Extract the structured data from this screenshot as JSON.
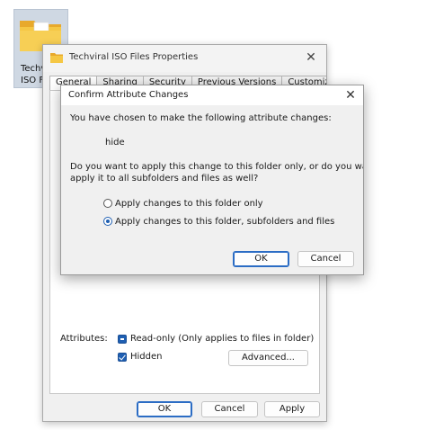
{
  "desktop": {
    "folder_label_line1": "Techvi",
    "folder_label_line2": "ISO F"
  },
  "properties_window": {
    "title": "Techviral ISO Files Properties",
    "tabs": [
      {
        "label": "General",
        "active": true
      },
      {
        "label": "Sharing",
        "active": false
      },
      {
        "label": "Security",
        "active": false
      },
      {
        "label": "Previous Versions",
        "active": false
      },
      {
        "label": "Customize",
        "active": false
      }
    ],
    "attributes_label": "Attributes:",
    "readonly_label": "Read-only (Only applies to files in folder)",
    "hidden_label": "Hidden",
    "advanced_button": "Advanced...",
    "ok_button": "OK",
    "cancel_button": "Cancel",
    "apply_button": "Apply"
  },
  "confirm_dialog": {
    "title": "Confirm Attribute Changes",
    "intro": "You have chosen to make the following attribute changes:",
    "change": "hide",
    "question_line1": "Do you want to apply this change to this folder only, or do you want to",
    "question_line2": "apply it to all subfolders and files as well?",
    "option_folder_only": "Apply changes to this folder only",
    "option_all": "Apply changes to this folder, subfolders and files",
    "selected_option": "option_all",
    "ok_button": "OK",
    "cancel_button": "Cancel"
  },
  "colors": {
    "accent": "#1f5fb2",
    "folder_yellow": "#f2c13a",
    "dialog_body": "#f0f0f0"
  }
}
